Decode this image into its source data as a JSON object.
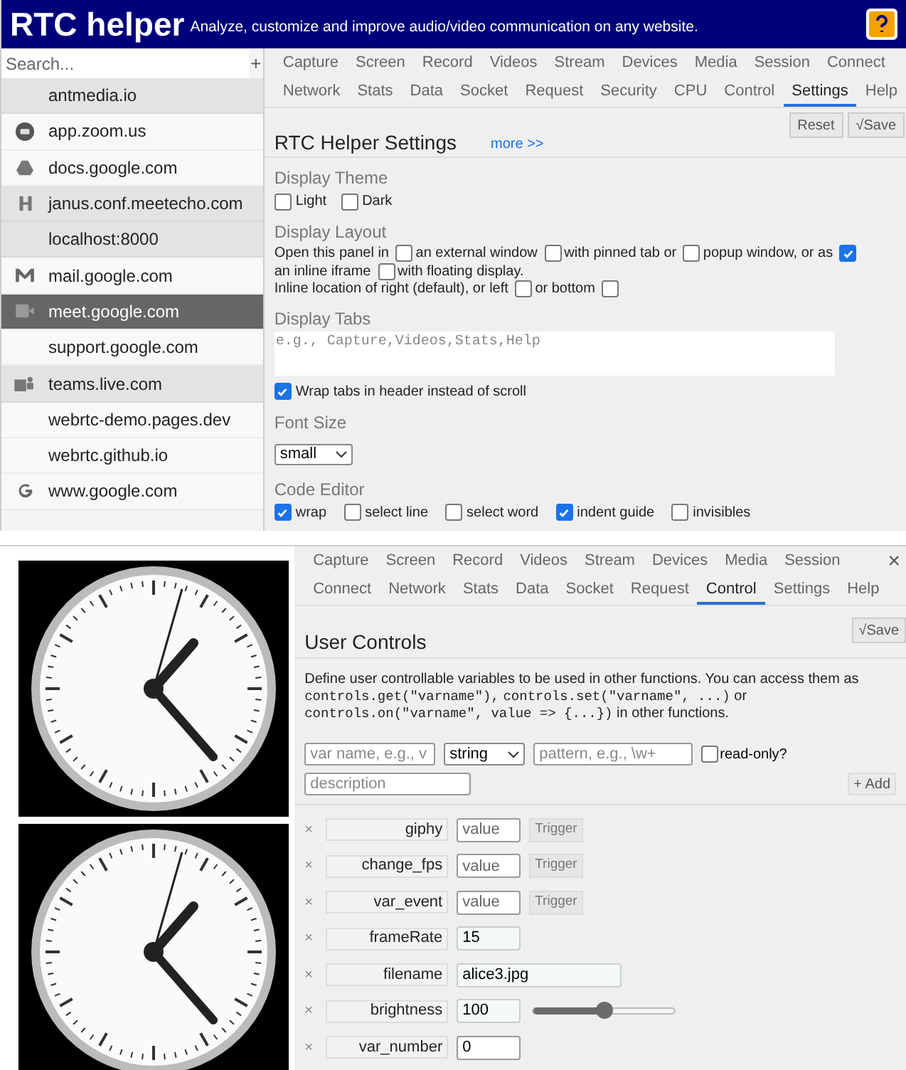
{
  "header": {
    "title": "RTC helper",
    "subtitle": "Analyze, customize and improve audio/video communication on any website."
  },
  "sidebar": {
    "search_placeholder": "Search...",
    "add": "+",
    "items": [
      {
        "label": "antmedia.io",
        "kind": "plain",
        "shaded": true,
        "selected": false
      },
      {
        "label": "app.zoom.us",
        "kind": "icon",
        "shaded": false,
        "selected": false
      },
      {
        "label": "docs.google.com",
        "kind": "icon",
        "shaded": false,
        "selected": false
      },
      {
        "label": "janus.conf.meetecho.com",
        "kind": "icon",
        "shaded": true,
        "selected": false
      },
      {
        "label": "localhost:8000",
        "kind": "plain",
        "shaded": true,
        "selected": false
      },
      {
        "label": "mail.google.com",
        "kind": "icon",
        "shaded": false,
        "selected": false
      },
      {
        "label": "meet.google.com",
        "kind": "icon",
        "shaded": false,
        "selected": true
      },
      {
        "label": "support.google.com",
        "kind": "plain",
        "shaded": false,
        "selected": false
      },
      {
        "label": "teams.live.com",
        "kind": "icon",
        "shaded": true,
        "selected": false
      },
      {
        "label": "webrtc-demo.pages.dev",
        "kind": "plain",
        "shaded": false,
        "selected": false
      },
      {
        "label": "webrtc.github.io",
        "kind": "plain",
        "shaded": false,
        "selected": false
      },
      {
        "label": "www.google.com",
        "kind": "icon",
        "shaded": false,
        "selected": false
      }
    ]
  },
  "settings_panel": {
    "tab_rows": [
      [
        {
          "label": "Capture",
          "selected": false
        },
        {
          "label": "Screen",
          "selected": false
        },
        {
          "label": "Record",
          "selected": false
        },
        {
          "label": "Videos",
          "selected": false
        },
        {
          "label": "Stream",
          "selected": false
        },
        {
          "label": "Devices",
          "selected": false
        },
        {
          "label": "Media",
          "selected": false
        },
        {
          "label": "Session",
          "selected": false
        },
        {
          "label": "Connect",
          "selected": false
        }
      ],
      [
        {
          "label": "Network",
          "selected": false
        },
        {
          "label": "Stats",
          "selected": false
        },
        {
          "label": "Data",
          "selected": false
        },
        {
          "label": "Socket",
          "selected": false
        },
        {
          "label": "Request",
          "selected": false
        },
        {
          "label": "Security",
          "selected": false
        },
        {
          "label": "CPU",
          "selected": false
        },
        {
          "label": "Control",
          "selected": false
        },
        {
          "label": "Settings",
          "selected": true
        },
        {
          "label": "Help",
          "selected": false
        }
      ]
    ],
    "title": "RTC Helper Settings",
    "more_link": "more >>",
    "buttons": [
      "Reset",
      "√Save"
    ],
    "theme": {
      "heading": "Display Theme",
      "options": [
        {
          "label": "Light",
          "checked": false
        },
        {
          "label": "Dark",
          "checked": false
        }
      ]
    },
    "layout": {
      "heading": "Display Layout",
      "lines": [
        [
          {
            "kind": "text",
            "text": "Open this panel in"
          },
          {
            "kind": "checkbox",
            "checked": false
          },
          {
            "kind": "text",
            "text": "an external window"
          },
          {
            "kind": "checkbox",
            "checked": false
          },
          {
            "kind": "text",
            "text": "with pinned tab or"
          },
          {
            "kind": "checkbox",
            "checked": false
          },
          {
            "kind": "text",
            "text": "popup window, or as"
          },
          {
            "kind": "checkbox",
            "checked": true
          },
          {
            "kind": "text",
            "text": "an inline"
          },
          {
            "kind": "text",
            "text": "iframe"
          },
          {
            "kind": "checkbox",
            "checked": false
          },
          {
            "kind": "text",
            "text": "with floating display."
          }
        ],
        [
          {
            "kind": "text",
            "text": "Inline location of right (default), or left"
          },
          {
            "kind": "checkbox",
            "checked": false
          },
          {
            "kind": "text",
            "text": "or bottom"
          },
          {
            "kind": "checkbox",
            "checked": false
          }
        ]
      ]
    },
    "tabs_field": {
      "heading": "Display Tabs",
      "placeholder": "e.g., Capture,Videos,Stats,Help",
      "wrap": {
        "label": "Wrap tabs in header instead of scroll",
        "checked": true
      }
    },
    "font_size": {
      "heading": "Font Size",
      "value": "small"
    },
    "code_editor": {
      "heading": "Code Editor",
      "options": [
        {
          "label": "wrap",
          "checked": true
        },
        {
          "label": "select line",
          "checked": false
        },
        {
          "label": "select word",
          "checked": false
        },
        {
          "label": "indent guide",
          "checked": true
        },
        {
          "label": "invisibles",
          "checked": false
        }
      ]
    }
  },
  "control_panel": {
    "tab_rows": [
      [
        {
          "label": "Capture",
          "selected": false
        },
        {
          "label": "Screen",
          "selected": false
        },
        {
          "label": "Record",
          "selected": false
        },
        {
          "label": "Videos",
          "selected": false
        },
        {
          "label": "Stream",
          "selected": false
        },
        {
          "label": "Devices",
          "selected": false
        },
        {
          "label": "Media",
          "selected": false
        },
        {
          "label": "Session",
          "selected": false
        }
      ],
      [
        {
          "label": "Connect",
          "selected": false
        },
        {
          "label": "Network",
          "selected": false
        },
        {
          "label": "Stats",
          "selected": false
        },
        {
          "label": "Data",
          "selected": false
        },
        {
          "label": "Socket",
          "selected": false
        },
        {
          "label": "Request",
          "selected": false
        },
        {
          "label": "Control",
          "selected": true
        },
        {
          "label": "Settings",
          "selected": false
        },
        {
          "label": "Help",
          "selected": false
        }
      ]
    ],
    "close": "×",
    "title": "User Controls",
    "save": "√Save",
    "description": [
      {
        "kind": "text",
        "text": "Define user controllable variables to be used in other functions. You can access them as"
      },
      {
        "kind": "code",
        "text": "controls.get(\"varname\"),"
      },
      {
        "kind": "code",
        "text": "controls.set(\"varname\", ...)"
      },
      {
        "kind": "text",
        "text": "or"
      },
      {
        "kind": "code",
        "text": "controls.on(\"varname\", value => {...})"
      },
      {
        "kind": "text",
        "text": "in other functions."
      }
    ],
    "form": {
      "name_placeholder": "var name, e.g., v",
      "type": "string",
      "pattern_placeholder": "pattern, e.g., \\w+",
      "readonly": {
        "label": "read-only?",
        "checked": false
      },
      "description_placeholder": "description",
      "add": "+ Add"
    },
    "variables": [
      {
        "kind": "trigger",
        "remove": "×",
        "name": "giphy",
        "placeholder": "value",
        "button": "Trigger"
      },
      {
        "kind": "trigger",
        "remove": "×",
        "name": "change_fps",
        "placeholder": "value",
        "button": "Trigger"
      },
      {
        "kind": "trigger",
        "remove": "×",
        "name": "var_event",
        "placeholder": "value",
        "button": "Trigger"
      },
      {
        "kind": "readonly",
        "remove": "×",
        "name": "frameRate",
        "value": "15"
      },
      {
        "kind": "text",
        "remove": "×",
        "name": "filename",
        "value": "alice3.jpg"
      },
      {
        "kind": "range",
        "remove": "×",
        "name": "brightness",
        "value": "100",
        "level": 0.5
      },
      {
        "kind": "number",
        "remove": "×",
        "name": "var_number",
        "value": "0"
      }
    ]
  }
}
